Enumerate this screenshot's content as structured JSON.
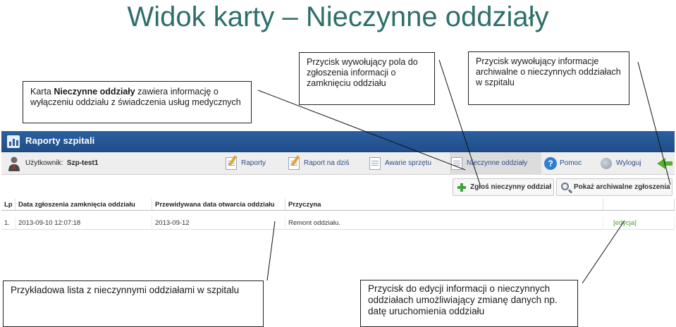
{
  "slide": {
    "title": "Widok karty – Nieczynne oddziały"
  },
  "callouts": {
    "card_pre": "Karta ",
    "card_bold": "Nieczynne oddziały",
    "card_post": " zawiera informację o wyłączeniu oddziału z świadczenia usług medycznych",
    "report_button": "Przycisk wywołujący pola do zgłoszenia informacji o zamknięciu oddziału",
    "archive_button": "Przycisk wywołujący informacje archiwalne o nieczynnych oddziałach w szpitalu",
    "sample_list": "Przykładowa lista z nieczynnymi oddziałami w szpitalu",
    "edit_button": "Przycisk do edycji informacji o nieczynnych oddziałach umożliwiający zmianę danych np. datę uruchomienia oddziału"
  },
  "app": {
    "title": "Raporty szpitali",
    "user_label": "Użytkownik:",
    "user_name": "Szp-test1",
    "nav": [
      {
        "label": "Raporty"
      },
      {
        "label": "Raport na dziś"
      },
      {
        "label": "Awarie sprzętu"
      },
      {
        "label": "Nieczynne oddziały"
      },
      {
        "label": "Pomoc"
      },
      {
        "label": "Wyloguj"
      }
    ],
    "buttons": {
      "report": "Zgłoś nieczynny oddział",
      "archive": "Pokaż archiwalne zgłoszenia"
    },
    "table": {
      "headers": [
        "Lp",
        "Data zgłoszenia zamknięcia oddziału",
        "Przewidywana data otwarcia oddziału",
        "Przyczyna",
        ""
      ],
      "rows": [
        [
          "1.",
          "2013-09-10 12:07:18",
          "2013-09-12",
          "Remont oddziału.",
          "[edycja]"
        ]
      ]
    }
  },
  "colors": {
    "title": "#2e6f6a",
    "header_bar": "#2a5fa0",
    "nav_link": "#2c4d86",
    "edit_link": "#4b9f2e",
    "plus_icon": "#3fa43a"
  },
  "icons": {
    "app_logo": "chart-logo-icon",
    "user": "user-avatar-icon",
    "nav_doc": "document-pencil-icon",
    "help": "question-icon",
    "logout": "logout-icon",
    "back": "green-back-arrow-icon",
    "plus": "plus-icon",
    "search": "magnifier-icon"
  }
}
